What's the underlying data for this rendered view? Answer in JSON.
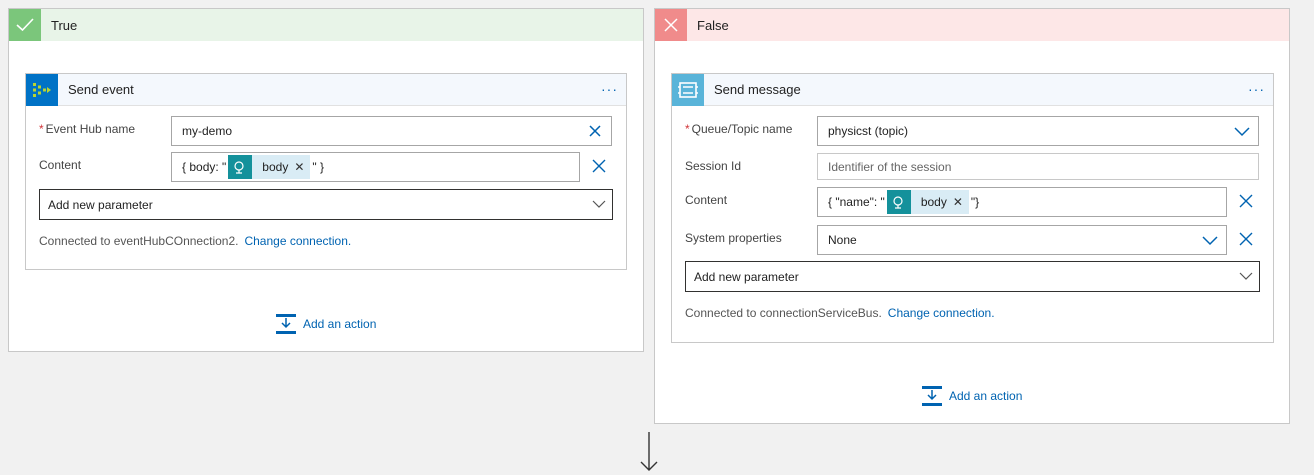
{
  "true_branch": {
    "title": "True",
    "card": {
      "title": "Send event",
      "more": "···",
      "event_hub": {
        "label": "Event Hub name",
        "value": "my-demo"
      },
      "content": {
        "label": "Content",
        "prefix": "{ body: \"",
        "token": "body",
        "suffix": "\" }"
      },
      "add_param": "Add new parameter",
      "connection": {
        "text": "Connected to eventHubCOnnection2.",
        "link": "Change connection."
      }
    },
    "add_action": "Add an action"
  },
  "false_branch": {
    "title": "False",
    "card": {
      "title": "Send message",
      "more": "···",
      "queue": {
        "label": "Queue/Topic name",
        "value": "physicst (topic)"
      },
      "session": {
        "label": "Session Id",
        "placeholder": "Identifier of the session"
      },
      "content": {
        "label": "Content",
        "prefix": "{ \"name\": \"",
        "token": "body",
        "suffix": "\"}"
      },
      "system_props": {
        "label": "System properties",
        "value": "None"
      },
      "add_param": "Add new parameter",
      "connection": {
        "text": "Connected to connectionServiceBus.",
        "link": "Change connection."
      }
    },
    "add_action": "Add an action"
  },
  "colors": {
    "true_header": "#e8f4e8",
    "true_badge": "#7bc67b",
    "false_header": "#fde7e7",
    "false_badge": "#f08b8b",
    "link": "#0063b1",
    "token_icon": "#14919b",
    "token_bg": "#d9ecf5"
  },
  "icons": {
    "true_badge": "check-icon",
    "false_badge": "close-icon",
    "event_hub": "event-hubs-icon",
    "service_bus": "service-bus-icon",
    "token": "http-request-icon",
    "add_action": "add-action-icon",
    "flow_arrow": "arrow-down-icon"
  }
}
